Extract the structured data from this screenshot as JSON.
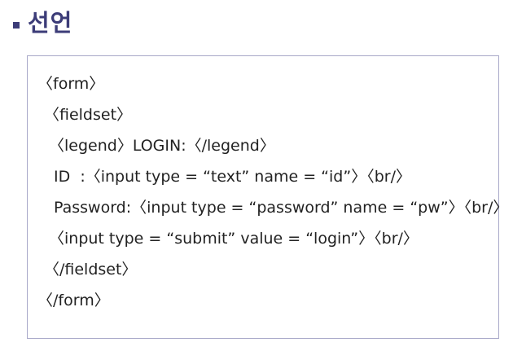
{
  "heading": {
    "title": "선언"
  },
  "code": {
    "lines": [
      "〈form〉",
      "〈fieldset〉",
      "〈legend〉LOGIN:〈/legend〉",
      "ID  :〈input type = “text” name = “id”〉〈br/〉",
      "Password:〈input type = “password” name = “pw”〉〈br/〉",
      "〈input type = “submit” value = “login”〉〈br/〉",
      "〈/fieldset〉",
      "〈/form〉"
    ]
  },
  "colors": {
    "accent": "#3c3c78",
    "border": "#a8a8c8"
  }
}
